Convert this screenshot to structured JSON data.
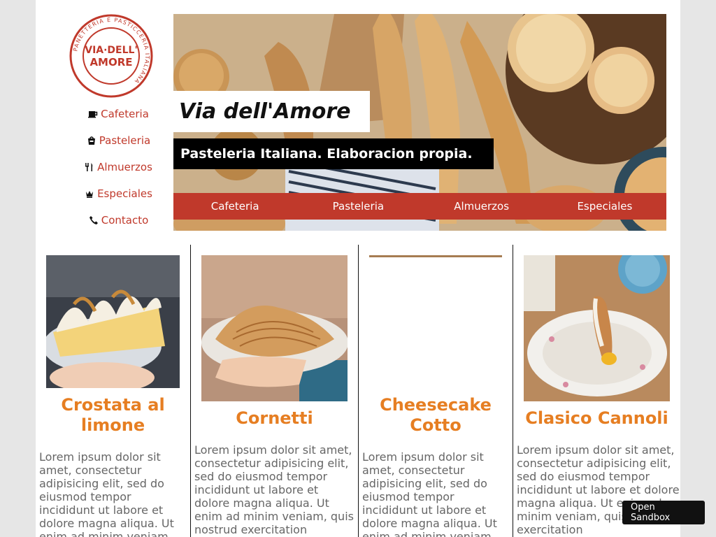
{
  "brand": {
    "logo_text": "VIA·DELL' AMORE",
    "logo_ring_text": "PANETTERIA E PASTICCERIA ITALIANA",
    "accent_color": "#c0392b",
    "title_color": "#e67e22"
  },
  "side_nav": [
    {
      "label": "Cafeteria",
      "icon": "coffee-cup-icon"
    },
    {
      "label": "Pasteleria",
      "icon": "cake-bag-icon"
    },
    {
      "label": "Almuerzos",
      "icon": "fork-knife-icon"
    },
    {
      "label": "Especiales",
      "icon": "crown-icon"
    },
    {
      "label": "Contacto",
      "icon": "phone-icon"
    }
  ],
  "hero": {
    "title": "Via dell'Amore",
    "subtitle": "Pasteleria Italiana. Elaboracion propia."
  },
  "top_nav": [
    {
      "label": "Cafeteria"
    },
    {
      "label": "Pasteleria"
    },
    {
      "label": "Almuerzos"
    },
    {
      "label": "Especiales"
    }
  ],
  "products": [
    {
      "title": "Crostata al limone",
      "image": "lemon meringue tart slice",
      "desc": "Lorem ipsum dolor sit amet, consectetur adipisicing elit, sed do eiusmod tempor incididunt ut labore et dolore magna aliqua. Ut enim ad minim veniam,"
    },
    {
      "title": "Cornetti",
      "image": "sfogliatella pastry on plate",
      "desc": "Lorem ipsum dolor sit amet, consectetur adipisicing elit, sed do eiusmod tempor incididunt ut labore et dolore magna aliqua. Ut enim ad minim veniam, quis nostrud exercitation"
    },
    {
      "title": "Cheesecake Cotto",
      "image": "",
      "desc": "Lorem ipsum dolor sit amet, consectetur adipisicing elit, sed do eiusmod tempor incididunt ut labore et dolore magna aliqua. Ut enim ad minim veniam,"
    },
    {
      "title": "Clasico Cannoli",
      "image": "cannolo on floral plate",
      "desc": "Lorem ipsum dolor sit amet, consectetur adipisicing elit, sed do eiusmod tempor incididunt ut labore et dolore magna aliqua. Ut enim ad minim veniam, quis nostrud exercitation"
    }
  ],
  "sandbox_button": "Open Sandbox"
}
